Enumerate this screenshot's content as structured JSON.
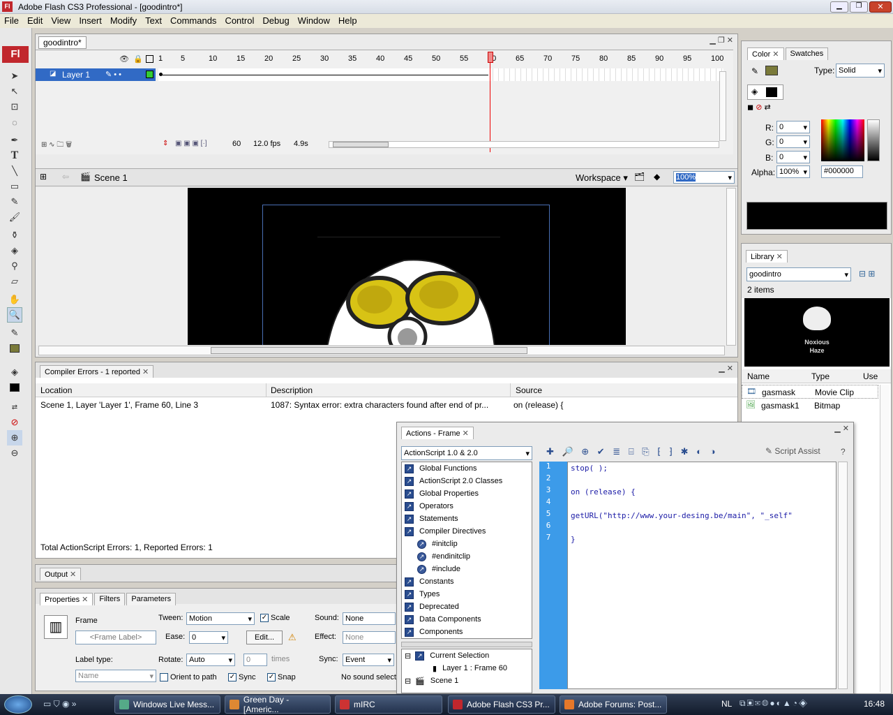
{
  "window": {
    "title": "Adobe Flash CS3 Professional - [goodintro*]"
  },
  "menu": [
    "File",
    "Edit",
    "View",
    "Insert",
    "Modify",
    "Text",
    "Commands",
    "Control",
    "Debug",
    "Window",
    "Help"
  ],
  "document": {
    "tab": "goodintro*"
  },
  "timeline": {
    "frame_numbers": [
      "1",
      "5",
      "10",
      "15",
      "20",
      "25",
      "30",
      "35",
      "40",
      "45",
      "50",
      "55",
      "60",
      "65",
      "70",
      "75",
      "80",
      "85",
      "90",
      "95",
      "100"
    ],
    "layer_name": "Layer 1",
    "current_frame": "60",
    "fps": "12.0 fps",
    "elapsed": "4.9s"
  },
  "editbar": {
    "scene": "Scene 1",
    "workspace": "Workspace",
    "zoom": "100%"
  },
  "color_panel": {
    "tabs": [
      "Color",
      "Swatches"
    ],
    "type_label": "Type:",
    "type_value": "Solid",
    "r_label": "R:",
    "r": "0",
    "g_label": "G:",
    "g": "0",
    "b_label": "B:",
    "b": "0",
    "alpha_label": "Alpha:",
    "alpha": "100%",
    "hex": "#000000",
    "preview_color": "#000000"
  },
  "library": {
    "tab": "Library",
    "doc": "goodintro",
    "count": "2 items",
    "preview_text1": "Noxious",
    "preview_text2": "Haze",
    "headers": [
      "Name",
      "Type",
      "Use"
    ],
    "items": [
      {
        "name": "gasmask",
        "type": "Movie Clip"
      },
      {
        "name": "gasmask1",
        "type": "Bitmap"
      }
    ]
  },
  "compiler": {
    "tab": "Compiler Errors - 1 reported",
    "headers": [
      "Location",
      "Description",
      "Source"
    ],
    "row": {
      "location": "Scene 1, Layer 'Layer 1', Frame 60, Line 3",
      "description": "1087: Syntax error: extra characters found after end of pr...",
      "source": "on (release) {"
    },
    "total": "Total ActionScript Errors: 1,  Reported Errors: 1"
  },
  "output": {
    "tab": "Output"
  },
  "properties": {
    "tabs": [
      "Properties",
      "Filters",
      "Parameters"
    ],
    "frame_label": "Frame",
    "frame_placeholder": "<Frame Label>",
    "tween_label": "Tween:",
    "tween": "Motion",
    "scale": "Scale",
    "ease_label": "Ease:",
    "ease": "0",
    "edit": "Edit...",
    "rotate_label": "Rotate:",
    "rotate": "Auto",
    "times_value": "0",
    "times": "times",
    "orient": "Orient to path",
    "sync": "Sync",
    "snap": "Snap",
    "label_type": "Label type:",
    "label_type_value": "Name",
    "sound_label": "Sound:",
    "sound": "None",
    "effect_label": "Effect:",
    "effect": "None",
    "sync_label": "Sync:",
    "sync_value": "Event",
    "no_sound": "No sound selecte"
  },
  "actions": {
    "title": "Actions - Frame",
    "language": "ActionScript 1.0 & 2.0",
    "script_assist": "Script Assist",
    "toolbox": [
      {
        "label": "Global Functions",
        "indent": 0
      },
      {
        "label": "ActionScript 2.0 Classes",
        "indent": 0
      },
      {
        "label": "Global Properties",
        "indent": 0
      },
      {
        "label": "Operators",
        "indent": 0
      },
      {
        "label": "Statements",
        "indent": 0
      },
      {
        "label": "Compiler Directives",
        "indent": 0
      },
      {
        "label": "#initclip",
        "indent": 1
      },
      {
        "label": "#endinitclip",
        "indent": 1
      },
      {
        "label": "#include",
        "indent": 1
      },
      {
        "label": "Constants",
        "indent": 0
      },
      {
        "label": "Types",
        "indent": 0
      },
      {
        "label": "Deprecated",
        "indent": 0
      },
      {
        "label": "Data Components",
        "indent": 0
      },
      {
        "label": "Components",
        "indent": 0
      }
    ],
    "tree": [
      {
        "label": "Current Selection"
      },
      {
        "label": "Layer 1 : Frame 60"
      },
      {
        "label": "Scene 1"
      }
    ],
    "lines": [
      "stop( );",
      "",
      "on (release) {",
      "",
      "getURL(\"http://www.your-desing.be/main\", \"_self\"",
      "",
      "}"
    ],
    "line_numbers": [
      "1",
      "2",
      "3",
      "4",
      "5",
      "6",
      "7"
    ]
  },
  "taskbar": {
    "items": [
      "Windows Live Mess...",
      "Green Day - [Americ...",
      "mIRC",
      "Adobe Flash CS3 Pr...",
      "Adobe Forums: Post..."
    ],
    "lang": "NL",
    "clock": "16:48"
  }
}
